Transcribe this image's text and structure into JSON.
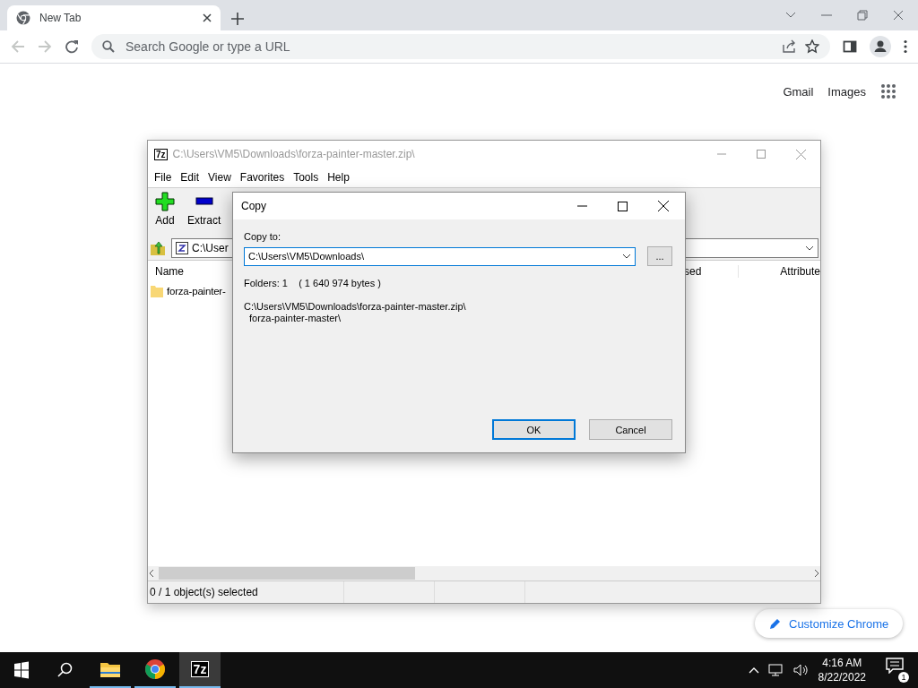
{
  "browser": {
    "tabs": [
      {
        "title": "New Tab",
        "selected": true
      }
    ],
    "omnibox": {
      "placeholder": "Search Google or type a URL"
    },
    "links": [
      "Gmail",
      "Images"
    ],
    "customize_button": "Customize Chrome"
  },
  "archive_window": {
    "logo": "7z",
    "title": "C:\\Users\\VM5\\Downloads\\forza-painter-master.zip\\",
    "menu": [
      "File",
      "Edit",
      "View",
      "Favorites",
      "Tools",
      "Help"
    ],
    "toolbar": [
      {
        "label": "Add",
        "kind": "add"
      },
      {
        "label": "Extract",
        "kind": "extract"
      }
    ],
    "address": "C:\\User",
    "columns": [
      "Name",
      "sed",
      "Attribute"
    ],
    "rows": [
      {
        "name": "forza-painter-"
      }
    ],
    "status": "0 / 1 object(s) selected"
  },
  "dialog": {
    "title": "Copy",
    "label": "Copy to:",
    "destination": "C:\\Users\\VM5\\Downloads\\",
    "browse": "...",
    "summary": "Folders: 1    ( 1 640 974 bytes )",
    "source_lines": [
      "C:\\Users\\VM5\\Downloads\\forza-painter-master.zip\\",
      "forza-painter-master\\"
    ],
    "buttons": [
      {
        "label": "OK",
        "default": true
      },
      {
        "label": "Cancel",
        "default": false
      }
    ]
  },
  "taskbar": {
    "apps": [
      {
        "kind": "explorer",
        "active": false
      },
      {
        "kind": "chrome",
        "active": false
      },
      {
        "kind": "sevenzip",
        "active": true,
        "logo": "7z"
      }
    ],
    "time": "4:16 AM",
    "date": "8/22/2022",
    "notifications": "1"
  }
}
